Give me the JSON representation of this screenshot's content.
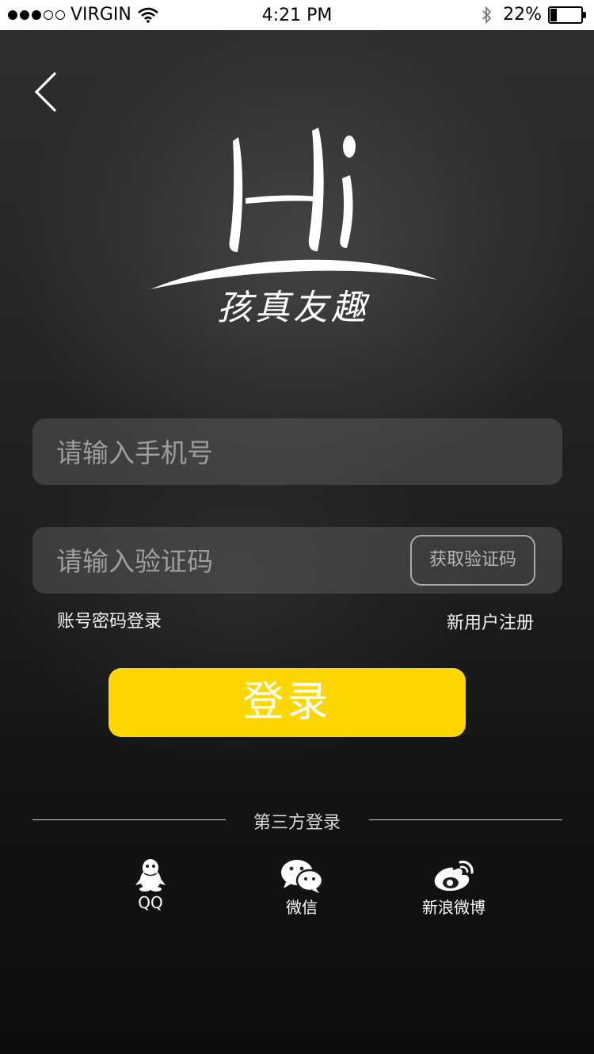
{
  "status_bar": {
    "carrier": "VIRGIN",
    "time": "4:21 PM",
    "battery": "22%",
    "battery_level": 0.22,
    "signal_bars_filled": 3,
    "signal_bars_total": 5,
    "icons": [
      "wifi-icon",
      "bluetooth-icon",
      "battery-icon"
    ]
  },
  "nav": {
    "back_icon": "chevron-left-icon"
  },
  "logo": {
    "wordmark": "Hi",
    "tagline": "孩真友趣"
  },
  "phone_field": {
    "placeholder": "请输入手机号",
    "value": ""
  },
  "code_field": {
    "placeholder": "请输入验证码",
    "value": "",
    "get_code_label": "获取验证码"
  },
  "links": {
    "password_login": "账号密码登录",
    "register": "新用户注册"
  },
  "login_button": {
    "label": "登录",
    "color": "#ffd700"
  },
  "third_party": {
    "title": "第三方登录",
    "items": [
      {
        "label": "QQ",
        "icon": "qq-penguin-icon"
      },
      {
        "label": "微信",
        "icon": "wechat-icon"
      },
      {
        "label": "新浪微博",
        "icon": "weibo-icon"
      }
    ]
  }
}
